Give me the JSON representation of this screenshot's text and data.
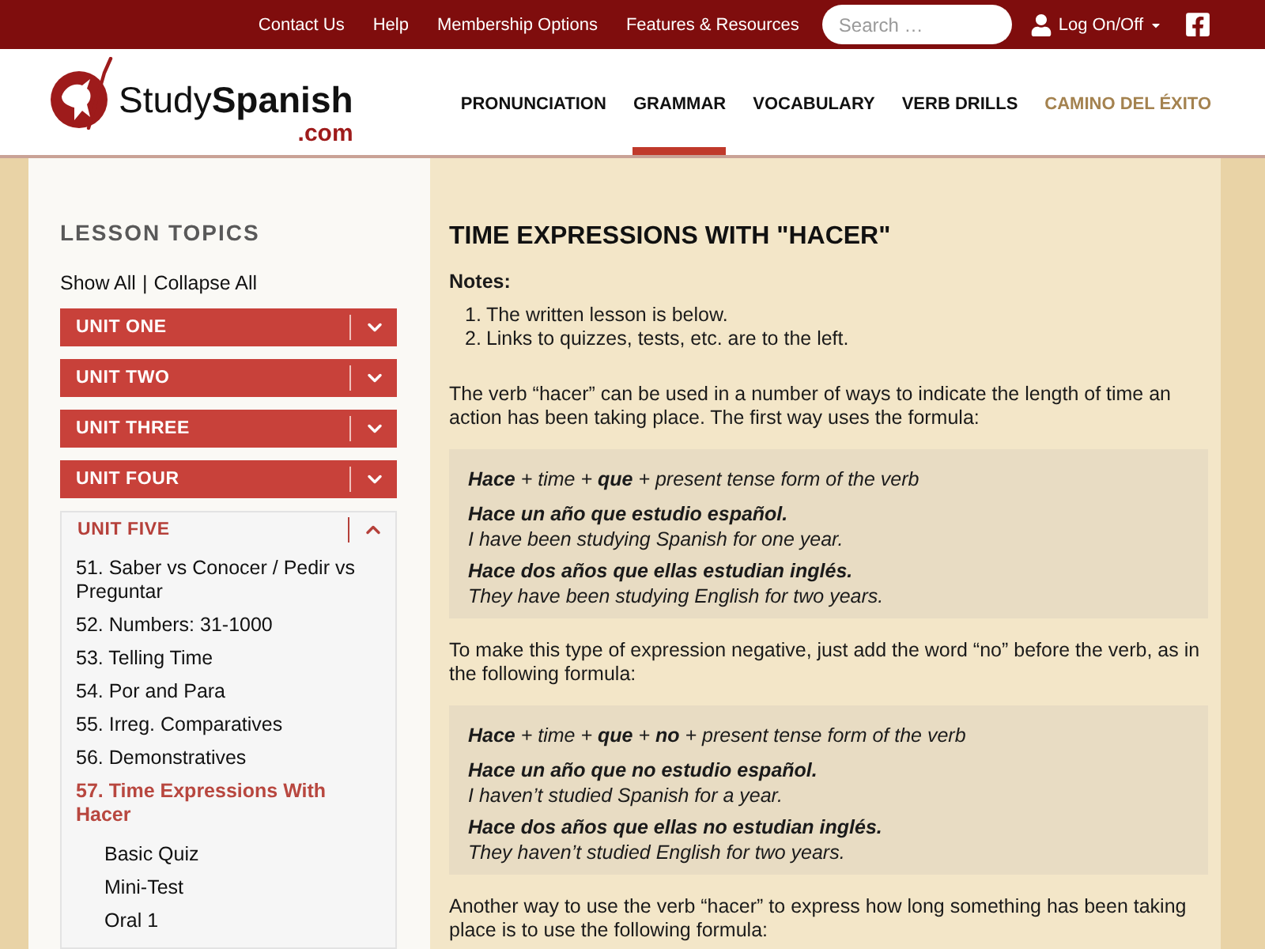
{
  "top_bar": {
    "links": [
      "Contact Us",
      "Help",
      "Membership Options",
      "Features & Resources"
    ],
    "search": {
      "placeholder": "Search …"
    },
    "account_menu": "Log On/Off"
  },
  "header": {
    "logo": {
      "name": "Study**Spanish**",
      "domain": ".com"
    },
    "nav": [
      {
        "label": "PRONUNCIATION",
        "kind": "regular",
        "selected": false
      },
      {
        "label": "GRAMMAR",
        "kind": "regular",
        "selected": true
      },
      {
        "label": "VOCABULARY",
        "kind": "regular",
        "selected": false
      },
      {
        "label": "VERB DRILLS",
        "kind": "regular",
        "selected": false
      },
      {
        "label": "CAMINO DEL ÉXITO",
        "kind": "special",
        "selected": false
      }
    ]
  },
  "sidebar": {
    "title": "LESSON TOPICS",
    "show_all": "Show All",
    "separator": "|",
    "collapse_all": "Collapse All",
    "units": [
      {
        "label": "UNIT ONE",
        "expanded": false
      },
      {
        "label": "UNIT TWO",
        "expanded": false
      },
      {
        "label": "UNIT THREE",
        "expanded": false
      },
      {
        "label": "UNIT FOUR",
        "expanded": false
      },
      {
        "label": "UNIT FIVE",
        "expanded": true,
        "lessons": [
          {
            "label": "51. Saber vs Conocer / Pedir vs Preguntar",
            "selected": false
          },
          {
            "label": "52. Numbers: 31-1000",
            "selected": false
          },
          {
            "label": "53. Telling Time",
            "selected": false
          },
          {
            "label": "54. Por and Para",
            "selected": false
          },
          {
            "label": "55. Irreg. Comparatives",
            "selected": false
          },
          {
            "label": "56. Demonstratives",
            "selected": false
          },
          {
            "label": "57. Time Expressions With Hacer",
            "selected": true,
            "children": [
              {
                "label": "Basic Quiz"
              },
              {
                "label": "Mini-Test"
              },
              {
                "label": "Oral 1"
              }
            ]
          }
        ]
      }
    ]
  },
  "lesson": {
    "title": "TIME EXPRESSIONS WITH \"HACER\"",
    "notes_label": "Notes:",
    "notes": [
      {
        "number": "1.",
        "text": "The written lesson is below."
      },
      {
        "number": "2.",
        "text": "Links to quizzes, tests, etc. are to the left."
      }
    ],
    "blocks": [
      {
        "kind": "paragraph",
        "text": "The verb “hacer” can be used in a number of ways to indicate the length of time an action has been taking place. The first way uses the formula:"
      },
      {
        "kind": "examples",
        "formula": "**Hace** + time + **que** + present tense form of the verb",
        "examples": [
          {
            "spanish": "Hace un año que estudio español.",
            "english": "I have been studying Spanish for one year."
          },
          {
            "spanish": "Hace dos años que ellas estudian inglés.",
            "english": "They have been studying English for two years."
          }
        ]
      },
      {
        "kind": "paragraph",
        "text": "To make this type of expression negative, just add the word “no” before the verb, as in the following formula:"
      },
      {
        "kind": "examples",
        "formula": "**Hace** + time + **que** + **no** + present tense form of the verb",
        "examples": [
          {
            "spanish": "Hace un año que no estudio español.",
            "english": "I haven’t studied Spanish for a year."
          },
          {
            "spanish": "Hace dos años que ellas no estudian inglés.",
            "english": "They haven’t studied English for two years."
          }
        ]
      },
      {
        "kind": "paragraph",
        "text": "Another way to use the verb “hacer” to express how long something has been taking place is to use the following formula:"
      }
    ]
  }
}
